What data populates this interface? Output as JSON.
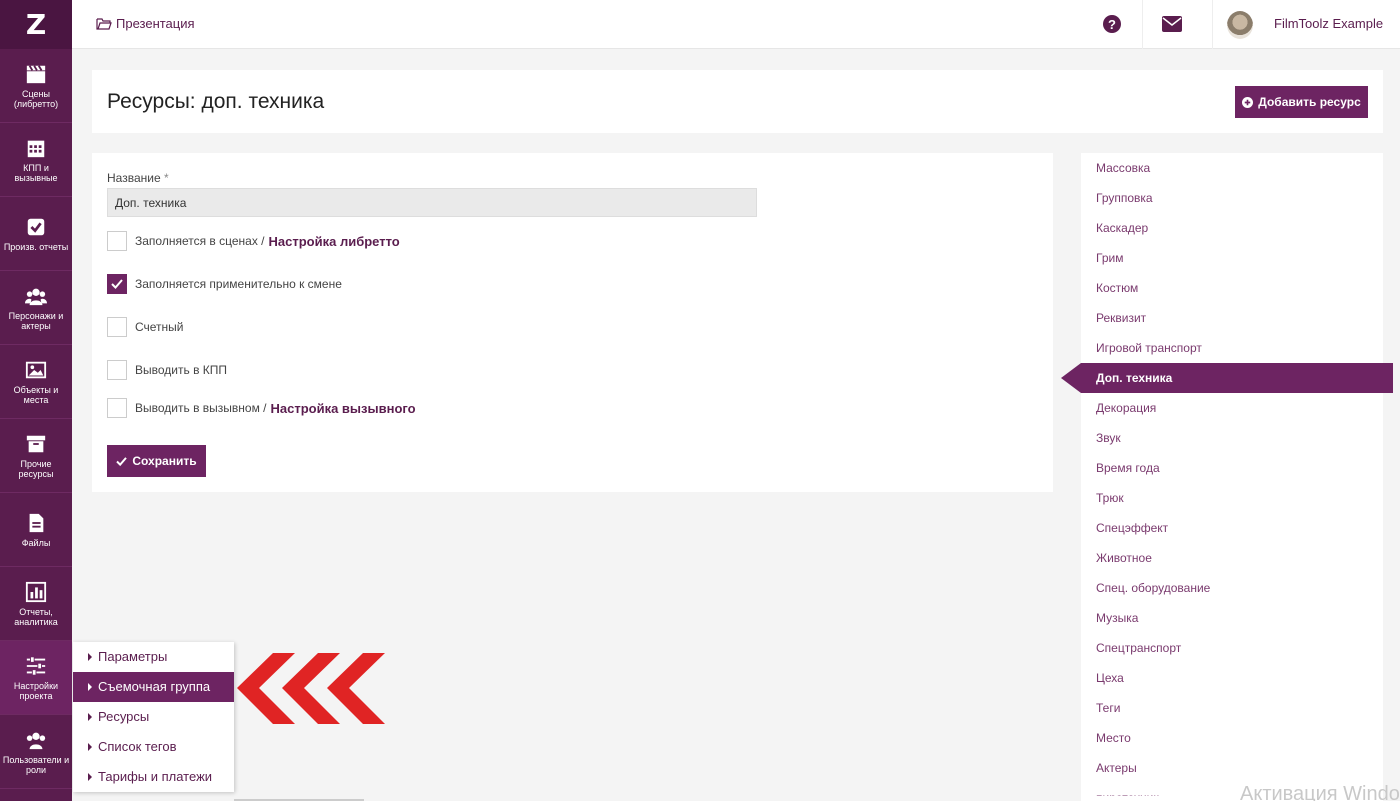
{
  "breadcrumb": {
    "label": "Презентация",
    "icon": "folder-open-icon"
  },
  "topbar": {
    "username": "FilmToolz Example"
  },
  "sidebar": {
    "items": [
      {
        "label": "Сцены (либретто)",
        "icon": "clapperboard-icon"
      },
      {
        "label": "КПП и вызывные",
        "icon": "calendar-icon"
      },
      {
        "label": "Произв. отчеты",
        "icon": "check-square-icon"
      },
      {
        "label": "Персонажи и актеры",
        "icon": "users-icon"
      },
      {
        "label": "Объекты и места",
        "icon": "image-icon"
      },
      {
        "label": "Прочие ресурсы",
        "icon": "archive-icon"
      },
      {
        "label": "Файлы",
        "icon": "file-icon"
      },
      {
        "label": "Отчеты, аналитика",
        "icon": "bar-chart-icon"
      },
      {
        "label": "Настройки проекта",
        "icon": "sliders-icon"
      },
      {
        "label": "Пользователи и роли",
        "icon": "users-icon"
      }
    ]
  },
  "header": {
    "title": "Ресурсы: доп. техника",
    "add_button": "Добавить ресурс"
  },
  "form": {
    "name_label": "Название",
    "required_mark": "*",
    "name_value": "Доп. техника",
    "options": [
      {
        "label": "Заполняется в сценах /",
        "link": "Настройка либретто",
        "checked": false
      },
      {
        "label": "Заполняется применительно к смене",
        "link": "",
        "checked": true
      },
      {
        "label": "Счетный",
        "link": "",
        "checked": false
      },
      {
        "label": "Выводить в КПП",
        "link": "",
        "checked": false
      },
      {
        "label": "Выводить в вызывном /",
        "link": "Настройка вызывного",
        "checked": false
      }
    ],
    "save_button": "Сохранить"
  },
  "resources": {
    "items": [
      "Массовка",
      "Групповка",
      "Каскадер",
      "Грим",
      "Костюм",
      "Реквизит",
      "Игровой транспорт",
      "Доп. техника",
      "Декорация",
      "Звук",
      "Время года",
      "Трюк",
      "Спецэффект",
      "Животное",
      "Спец. оборудование",
      "Музыка",
      "Спецтранспорт",
      "Цеха",
      "Теги",
      "Место",
      "Актеры",
      "пиротехник"
    ],
    "active_index": 7
  },
  "submenu": {
    "items": [
      "Параметры",
      "Съемочная группа",
      "Ресурсы",
      "Список тегов",
      "Тарифы и платежи"
    ],
    "active_index": 1
  },
  "watermark": "Активация Windo",
  "colors": {
    "brand": "#6d2462",
    "sidebar": "#5a1d4e",
    "arrow": "#e02424"
  }
}
